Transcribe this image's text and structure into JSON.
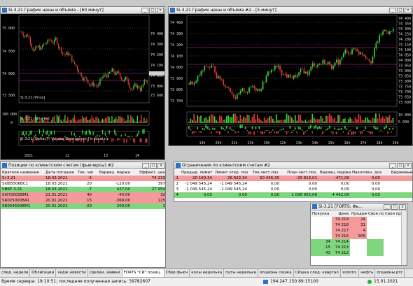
{
  "chart1": {
    "title": "Si-3.21 График цены и объёма - [60 минут]",
    "y_labels": [
      "75 000",
      "74 500",
      "74 000",
      "73 500"
    ],
    "right_labels": [
      "74 400",
      "74 300",
      "74 200",
      "74 100",
      "74 000",
      "73 800",
      "73 600"
    ],
    "price_caption": "Si-3.21 [Price]",
    "volume_caption": "Si-3.21 [Volume]",
    "volume_labels": [
      "100 000",
      "0"
    ],
    "delta_caption": "Si-3.21 [Delta (P/ Volume Divergence) ] k-pavel.ru",
    "x_labels": [
      "2021",
      "12",
      "13",
      "14"
    ]
  },
  "chart2": {
    "title": "Si-3.21 График цены и объёма #2 - [5 минут]",
    "y_labels": [
      "74 400",
      "74 300",
      "74 200",
      "74 100",
      "74 000",
      "73 900",
      "73 800",
      "73 700"
    ],
    "right_labels": [
      "74 400",
      "74 350",
      "74 300",
      "74 250",
      "74 200",
      "74 150",
      "74 100",
      "74 050",
      "74 000",
      "73 950",
      "73 900",
      "73 850",
      "73 800",
      "73 750",
      "73 700",
      "73 650",
      "73 600"
    ],
    "volume_labels": [
      "10 000",
      "5 000"
    ],
    "x_labels": [
      "19h",
      "20h",
      "22h",
      "23h",
      "10h",
      "12h",
      "13h",
      "14h",
      "15h",
      "16h",
      "17h",
      "18h",
      "19h"
    ]
  },
  "positions": {
    "title": "Позиции по клиентским счетам (фьючерсы) #2",
    "columns": [
      "Краткое название",
      "Дата погашен",
      "Тек. чист",
      "Вариац. маржа",
      "Эффект. цен"
    ],
    "rows": [
      {
        "name": "Si-3.21",
        "date": "18.03.2021",
        "pos": "-5",
        "var": "",
        "eff": "74 233",
        "color": "#f49a9a"
      },
      {
        "name": "Si085506BC1",
        "date": "18.03.2021",
        "pos": "20",
        "var": "-120,00",
        "eff": "397",
        "color": "#ffffff"
      },
      {
        "name": "SBRF-3.21",
        "date": "18.03.2021",
        "pos": "-7",
        "var": "427,00",
        "eff": "27 954",
        "color": "#7fd67f"
      },
      {
        "name": "Si072000BM1",
        "date": "21.01.2021",
        "pos": "40",
        "var": "-40,00",
        "eff": "32",
        "color": "#f49a9a"
      },
      {
        "name": "SR025000BA1",
        "date": "20.01.2021",
        "pos": "15",
        "var": "-368,00",
        "eff": "125",
        "color": "#f49a9a"
      },
      {
        "name": "SR024500BM1",
        "date": "20.01.2021",
        "pos": "-20",
        "var": "200,00",
        "eff": "1",
        "color": "#7fd67f"
      }
    ]
  },
  "limits": {
    "title": "Ограничения по клиентским счетам #2",
    "columns": [
      "",
      "Предыд. лимит",
      "Лимит откр. поз.",
      "Тек.чист.поз.",
      "План чист.поз.",
      "Вариац. маржа",
      "Накоплен. доход",
      "Биржевые"
    ],
    "rows": [
      {
        "n": "1",
        "a": "20 160,34",
        "b": "26 622,34",
        "c": "50 436,35",
        "d": "-25 813,01",
        "e": "-471,00",
        "f": "0,00",
        "color": "#f49a9a"
      },
      {
        "n": "2",
        "a": "-1 049 545,24",
        "b": "-1 049 545,24",
        "c": "0,00",
        "d": "0,00",
        "e": "0,00",
        "f": "0,00",
        "color": "#ffffff"
      },
      {
        "n": "3",
        "a": "-1 049 545,24",
        "b": "-1 049 545,24",
        "c": "0,00",
        "d": "0,00",
        "e": "0,00",
        "f": "0,00",
        "color": "#ffffff"
      },
      {
        "n": "4",
        "a": "0,00",
        "b": "0,00",
        "c": "0,00",
        "d": "1 099 955,06",
        "e": "4 462,00",
        "f": "0,00",
        "color": "#7fd67f"
      }
    ]
  },
  "orderbook": {
    "title": "Si-3.21 [FORTS: Фь...",
    "columns": [
      "Покупка",
      "Цена",
      "Продажа",
      "Своя пок",
      "Своя пр"
    ],
    "rows": [
      {
        "buy": "",
        "price": "74 219",
        "sell": "24"
      },
      {
        "buy": "",
        "price": "74 218",
        "sell": "31"
      },
      {
        "buy": "",
        "price": "74 217",
        "sell": "4"
      },
      {
        "buy": "",
        "price": "74 216",
        "sell": "905"
      },
      {
        "buy": "34",
        "price": "74 214",
        "sell": ""
      },
      {
        "buy": "15",
        "price": "74 213",
        "sell": ""
      },
      {
        "buy": "43",
        "price": "74 212",
        "sell": ""
      }
    ]
  },
  "taskbar": [
    "след. неделя",
    "Облигации",
    "хедж новости",
    "сделки, заявки",
    "FORTS \"СИ\" позиц..",
    "Сбер фьюч",
    "колы неделька",
    "путы неделька",
    "опционы сишка",
    "СИшка след. квартал",
    "золото.",
    "нефть",
    "опционы ртс"
  ],
  "status": {
    "text": "Время сервера: 19:10:51; последняя полученная запись: 39782607",
    "ip": "194.247.150.89:15100",
    "date": "15.01.2021"
  }
}
